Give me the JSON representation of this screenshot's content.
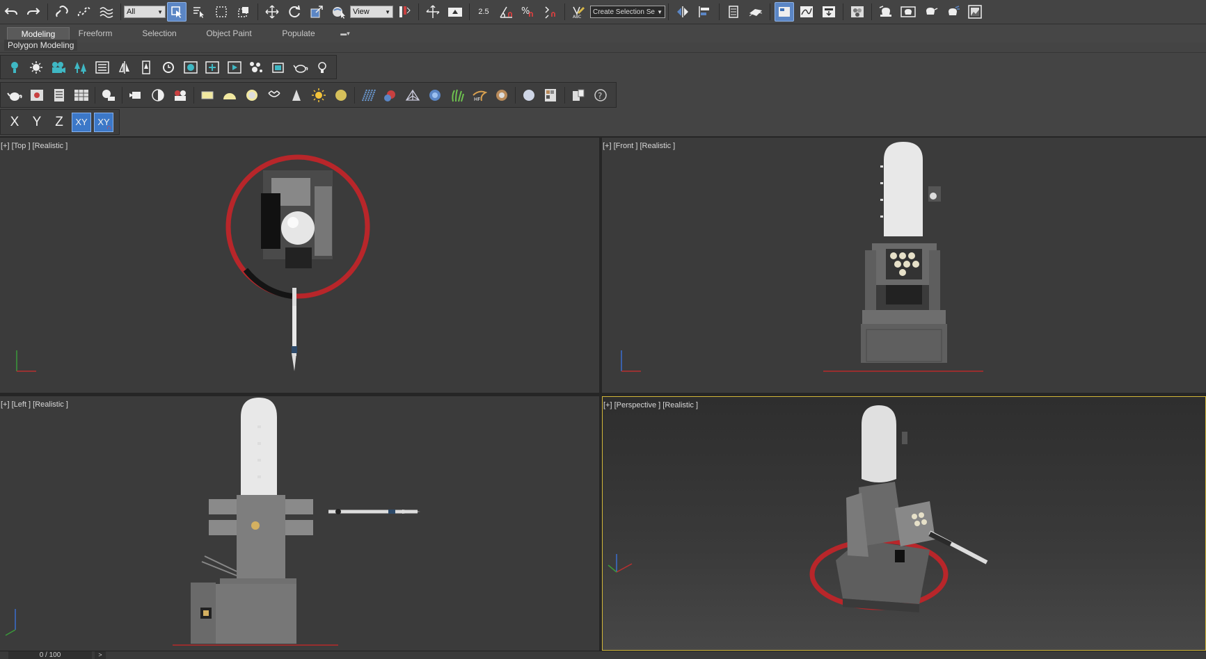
{
  "toolbar": {
    "selection_filter": "All",
    "ref_coord_system": "View",
    "angle_snap_label": "2.5",
    "named_selection_placeholder": "Create Selection Se",
    "icons": [
      "undo-icon",
      "redo-icon",
      "link-icon",
      "unlink-icon",
      "bind-spacewarp-icon",
      "select-object-icon",
      "select-by-name-icon",
      "rect-region-icon",
      "window-crossing-icon",
      "move-icon",
      "rotate-icon",
      "scale-icon",
      "select-manipulate-icon",
      "pivot-icon",
      "keyboard-shortcut-icon",
      "snap-toggle-icon",
      "angle-snap-icon",
      "percent-snap-icon",
      "spinner-snap-icon",
      "edit-named-sets-icon",
      "mirror-icon",
      "align-icon",
      "layer-explorer-icon",
      "scene-explorer-icon",
      "ribbon-toggle-icon",
      "curve-editor-icon",
      "schematic-view-icon",
      "material-editor-icon",
      "render-setup-icon",
      "rendered-frame-icon",
      "render-icon",
      "render-iterative-icon",
      "render-online-icon"
    ]
  },
  "ribbon": {
    "tabs": [
      "Modeling",
      "Freeform",
      "Selection",
      "Object Paint",
      "Populate"
    ],
    "active_tab": "Modeling",
    "panel_label": "Polygon Modeling"
  },
  "axis_constraints": {
    "x": "X",
    "y": "Y",
    "z": "Z",
    "xy": "XY",
    "xy_lock": "XY"
  },
  "viewports": {
    "top": "[+] [Top ] [Realistic ]",
    "front": "[+] [Front ] [Realistic ]",
    "left": "[+] [Left ] [Realistic ]",
    "perspective": "[+] [Perspective ] [Realistic ]"
  },
  "status": {
    "frame_counter": "0 / 100",
    "next_button": ">"
  },
  "colors": {
    "active_viewport_border": "#d3b83a",
    "selection_accent": "#5b86c5",
    "gizmo_red": "#b8262a"
  }
}
